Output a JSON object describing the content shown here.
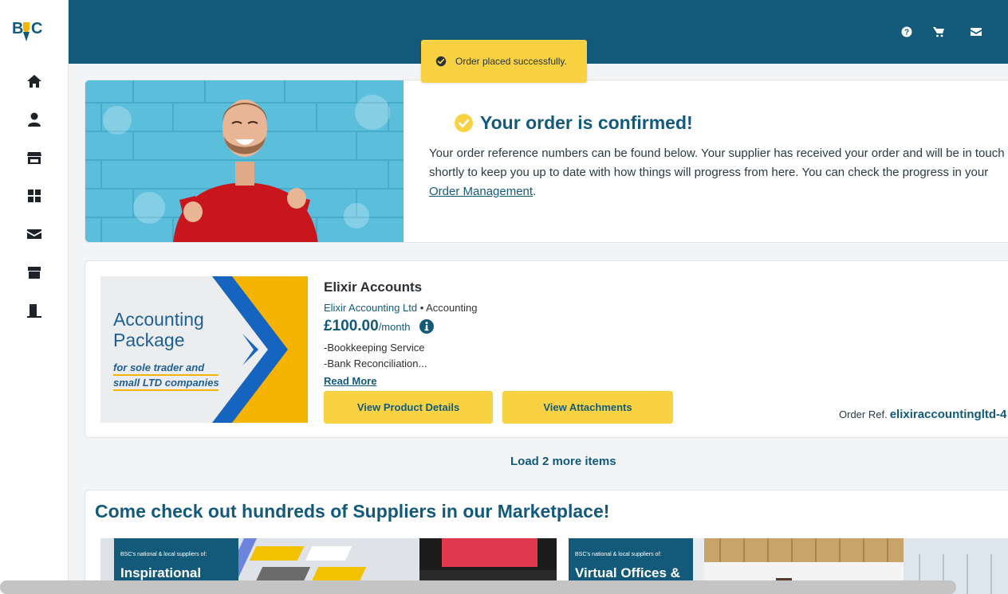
{
  "brand": {
    "logo_text": "BSC"
  },
  "sidebar": {
    "items": [
      {
        "name": "home"
      },
      {
        "name": "profile"
      },
      {
        "name": "marketplace"
      },
      {
        "name": "dashboard"
      },
      {
        "name": "messages"
      },
      {
        "name": "orders"
      },
      {
        "name": "logout"
      }
    ]
  },
  "header": {
    "icons": [
      "help-icon",
      "cart-icon",
      "mail-icon"
    ]
  },
  "toast": {
    "message": "Order placed successfully."
  },
  "confirmation": {
    "title": "Your order is confirmed!",
    "body_text": "Your order reference numbers can be found below. Your supplier has received your order and will be in touch shortly to keep you up to date with how things will progress from here. You can check the progress in your ",
    "link_text": "Order Management",
    "body_end": "."
  },
  "order": {
    "image": {
      "line1": "Accounting",
      "line2": "Package",
      "sub1": "for sole trader and",
      "sub2": "small LTD companies"
    },
    "product_name": "Elixir Accounts",
    "supplier": "Elixir Accounting Ltd",
    "separator": " • ",
    "category": "Accounting",
    "price": "£100.00",
    "price_unit": "/month",
    "features": [
      "-Bookkeeping Service",
      "-Bank Reconciliation..."
    ],
    "read_more": "Read More",
    "view_details_label": "View Product Details",
    "view_attachments_label": "View Attachments",
    "order_ref_label": "Order Ref.",
    "order_ref_value": "elixiraccountingltd-4"
  },
  "load_more": "Load 2 more items",
  "marketplace": {
    "title": "Come check out hundreds of Suppliers in our Marketplace!",
    "promos": [
      {
        "small": "BSC's national & local suppliers of:",
        "big": "Inspirational"
      },
      {
        "small": "BSC's national & local suppliers of:",
        "big": "Virtual Offices &"
      }
    ]
  },
  "colors": {
    "primary": "#135a7a",
    "accent": "#f9d243",
    "background": "#f2f4f5"
  }
}
